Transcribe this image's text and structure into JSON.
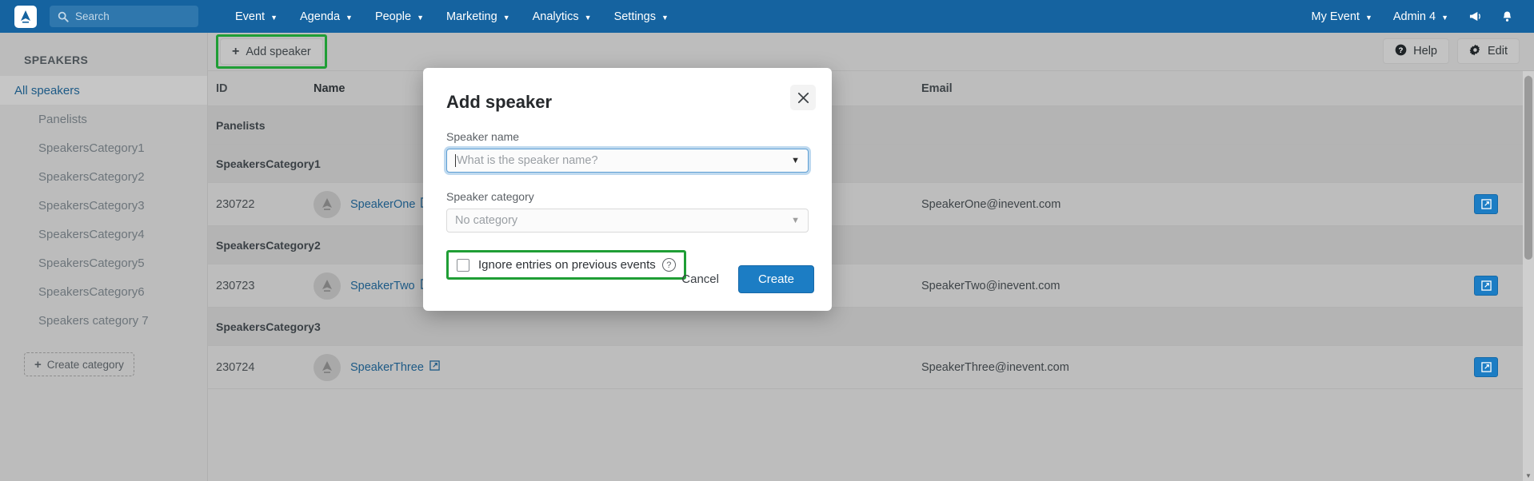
{
  "navbar": {
    "logo_icon": "inevent-logo-icon",
    "search": {
      "placeholder": "Search",
      "value": "",
      "icon": "search-icon"
    },
    "menu": [
      {
        "label": "Event"
      },
      {
        "label": "Agenda"
      },
      {
        "label": "People"
      },
      {
        "label": "Marketing"
      },
      {
        "label": "Analytics"
      },
      {
        "label": "Settings"
      }
    ],
    "right": {
      "event_label": "My Event",
      "admin_label": "Admin 4",
      "announcement_icon": "megaphone-icon",
      "notification_icon": "bell-icon"
    },
    "background": "#1563a0"
  },
  "sidebar": {
    "title": "SPEAKERS",
    "root_item": "All speakers",
    "items": [
      {
        "label": "Panelists"
      },
      {
        "label": "SpeakersCategory1"
      },
      {
        "label": "SpeakersCategory2"
      },
      {
        "label": "SpeakersCategory3"
      },
      {
        "label": "SpeakersCategory4"
      },
      {
        "label": "SpeakersCategory5"
      },
      {
        "label": "SpeakersCategory6"
      },
      {
        "label": "Speakers category 7"
      }
    ],
    "create_category": "Create category"
  },
  "toolbar": {
    "add_speaker": "Add speaker",
    "help": "Help",
    "edit": "Edit",
    "highlight_color": "#1f9e35"
  },
  "table": {
    "headers": {
      "id": "ID",
      "name": "Name",
      "email": "Email"
    },
    "groups": [
      {
        "label": "Panelists",
        "rows": []
      },
      {
        "label": "SpeakersCategory1",
        "rows": [
          {
            "id": "230722",
            "name": "SpeakerOne",
            "email": "SpeakerOne@inevent.com"
          }
        ]
      },
      {
        "label": "SpeakersCategory2",
        "rows": [
          {
            "id": "230723",
            "name": "SpeakerTwo",
            "email": "SpeakerTwo@inevent.com"
          }
        ]
      },
      {
        "label": "SpeakersCategory3",
        "rows": [
          {
            "id": "230724",
            "name": "SpeakerThree",
            "email": "SpeakerThree@inevent.com"
          }
        ]
      }
    ]
  },
  "modal": {
    "title": "Add speaker",
    "close_icon": "close-icon",
    "speaker_name_label": "Speaker name",
    "speaker_name_placeholder": "What is the speaker name?",
    "speaker_name_value": "",
    "speaker_category_label": "Speaker category",
    "speaker_category_value": "No category",
    "ignore_entries_label": "Ignore entries on previous events",
    "ignore_entries_checked": false,
    "help_glyph": "?",
    "cancel_label": "Cancel",
    "create_label": "Create",
    "create_color": "#1c7dc4"
  }
}
